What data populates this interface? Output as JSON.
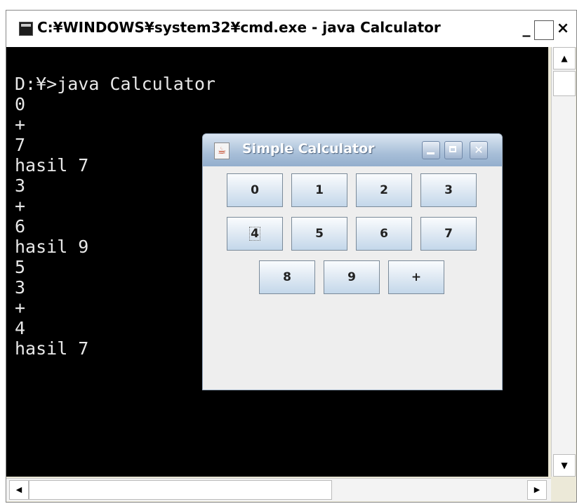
{
  "cmd": {
    "title": "C:¥WINDOWS¥system32¥cmd.exe - java Calculator",
    "controls": {
      "minimize": "_",
      "maximize": "□",
      "close": "×"
    },
    "console_lines": [
      "D:¥>java Calculator",
      "0",
      "+",
      "7",
      "hasil 7",
      "3",
      "+",
      "6",
      "hasil 9",
      "5",
      "3",
      "+",
      "4",
      "hasil 7"
    ]
  },
  "calculator": {
    "title": "Simple Calculator",
    "icon": "java-cup-icon",
    "buttons_row1": [
      "0",
      "1",
      "2",
      "3"
    ],
    "buttons_row2": [
      "4",
      "5",
      "6",
      "7"
    ],
    "buttons_row3": [
      "8",
      "9",
      "+"
    ],
    "focused_button": "4"
  }
}
